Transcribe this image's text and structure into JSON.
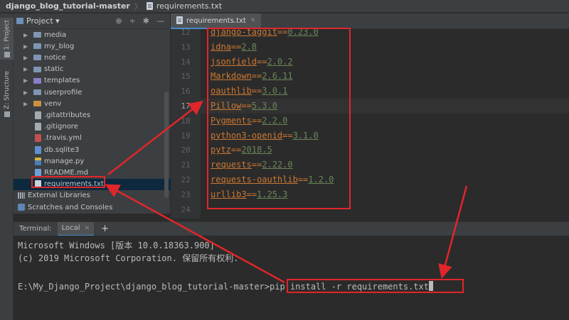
{
  "breadcrumb": {
    "project": "django_blog_tutorial-master",
    "file": "requirements.txt"
  },
  "tool_stripe": {
    "project_tab": "1: Project",
    "structure_tab": "Z: Structure"
  },
  "project_panel": {
    "title": "Project",
    "tools": [
      "⊕",
      "÷",
      "✱",
      "—"
    ],
    "tree": [
      {
        "label": "media",
        "kind": "folder",
        "arrow": "▶",
        "icon": "folder-icon"
      },
      {
        "label": "my_blog",
        "kind": "folder",
        "arrow": "▶",
        "icon": "folder-icon"
      },
      {
        "label": "notice",
        "kind": "folder",
        "arrow": "▶",
        "icon": "folder-icon"
      },
      {
        "label": "static",
        "kind": "folder",
        "arrow": "▶",
        "icon": "folder-icon"
      },
      {
        "label": "templates",
        "kind": "folder-purple",
        "arrow": "▶",
        "icon": "templates-folder-icon"
      },
      {
        "label": "userprofile",
        "kind": "folder",
        "arrow": "▶",
        "icon": "folder-icon"
      },
      {
        "label": "venv",
        "kind": "folder-orange",
        "arrow": "▶",
        "icon": "venv-folder-icon"
      },
      {
        "label": ".gitattributes",
        "kind": "git",
        "icon": "git-file-icon"
      },
      {
        "label": ".gitignore",
        "kind": "git",
        "icon": "git-file-icon"
      },
      {
        "label": ".travis.yml",
        "kind": "yml",
        "icon": "yaml-file-icon"
      },
      {
        "label": "db.sqlite3",
        "kind": "db",
        "icon": "database-file-icon"
      },
      {
        "label": "manage.py",
        "kind": "py",
        "icon": "python-file-icon"
      },
      {
        "label": "README.md",
        "kind": "md",
        "icon": "markdown-file-icon"
      },
      {
        "label": "requirements.txt",
        "kind": "txt",
        "icon": "text-file-icon",
        "selected": true
      },
      {
        "label": "External Libraries",
        "kind": "lib",
        "icon": "libraries-icon"
      },
      {
        "label": "Scratches and Consoles",
        "kind": "scratch",
        "icon": "scratches-icon"
      }
    ]
  },
  "editor": {
    "tab_label": "requirements.txt",
    "current_line": 17,
    "lines": [
      {
        "no": "12",
        "pkg": "django-taggit",
        "eq": "==",
        "ver": "0.23.0"
      },
      {
        "no": "13",
        "pkg": "idna",
        "eq": "==",
        "ver": "2.8"
      },
      {
        "no": "14",
        "pkg": "jsonfield",
        "eq": "==",
        "ver": "2.0.2"
      },
      {
        "no": "15",
        "pkg": "Markdown",
        "eq": "==",
        "ver": "2.6.11"
      },
      {
        "no": "16",
        "pkg": "oauthlib",
        "eq": "==",
        "ver": "3.0.1"
      },
      {
        "no": "17",
        "pkg": "Pillow",
        "eq": "==",
        "ver": "5.3.0"
      },
      {
        "no": "18",
        "pkg": "Pygments",
        "eq": "==",
        "ver": "2.2.0"
      },
      {
        "no": "19",
        "pkg": "python3-openid",
        "eq": "==",
        "ver": "3.1.0"
      },
      {
        "no": "20",
        "pkg": "pytz",
        "eq": "==",
        "ver": "2018.5"
      },
      {
        "no": "21",
        "pkg": "requests",
        "eq": "==",
        "ver": "2.22.0"
      },
      {
        "no": "22",
        "pkg": "requests-oauthlib",
        "eq": "==",
        "ver": "1.2.0"
      },
      {
        "no": "23",
        "pkg": "urllib3",
        "eq": "==",
        "ver": "1.25.3"
      },
      {
        "no": "24",
        "pkg": "",
        "eq": "",
        "ver": ""
      }
    ]
  },
  "terminal": {
    "label": "Terminal:",
    "tab": "Local",
    "new_tab": "+",
    "line1": "Microsoft Windows [版本 10.0.18363.900]",
    "line2": "(c) 2019 Microsoft Corporation. 保留所有权利.",
    "prompt": "E:\\My_Django_Project\\django_blog_tutorial-master>",
    "command": "pip install -r requirements.txt"
  },
  "colors": {
    "annotation": "#e0262b",
    "keyword": "#cc7832",
    "string": "#6a8759",
    "accent": "#4a88c7"
  }
}
